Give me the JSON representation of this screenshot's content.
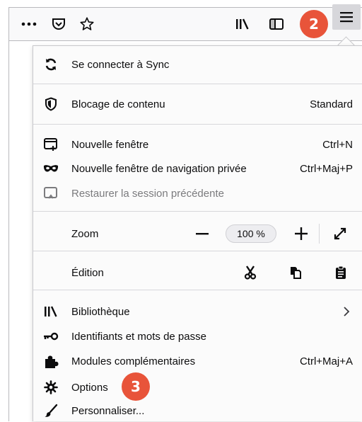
{
  "toolbar": {
    "icons": [
      "more-icon",
      "pocket-icon",
      "bookmark-star-icon",
      "library-icon",
      "sidebar-icon",
      "hamburger-menu-icon"
    ]
  },
  "badges": {
    "step2": "2",
    "step3": "3"
  },
  "menu": {
    "sync": {
      "label": "Se connecter à Sync",
      "icon": "sync-icon"
    },
    "content_blocking": {
      "label": "Blocage de contenu",
      "value": "Standard",
      "icon": "shield-icon"
    },
    "new_window": {
      "label": "Nouvelle fenêtre",
      "shortcut": "Ctrl+N",
      "icon": "new-window-icon"
    },
    "private_window": {
      "label": "Nouvelle fenêtre de navigation privée",
      "shortcut": "Ctrl+Maj+P",
      "icon": "mask-icon"
    },
    "restore_session": {
      "label": "Restaurer la session précédente",
      "icon": "restore-icon",
      "disabled": true
    },
    "zoom": {
      "label": "Zoom",
      "value": "100 %",
      "minus": "−",
      "plus": "+"
    },
    "edit": {
      "label": "Édition"
    },
    "library": {
      "label": "Bibliothèque",
      "icon": "library-icon"
    },
    "logins": {
      "label": "Identifiants et mots de passe",
      "icon": "key-icon"
    },
    "addons": {
      "label": "Modules complémentaires",
      "shortcut": "Ctrl+Maj+A",
      "icon": "puzzle-icon"
    },
    "options": {
      "label": "Options",
      "icon": "gear-icon"
    },
    "customize": {
      "label": "Personnaliser...",
      "icon": "paintbrush-icon"
    }
  },
  "colors": {
    "badge": "#e8543a",
    "menu_button_active": "#d7d7db"
  }
}
